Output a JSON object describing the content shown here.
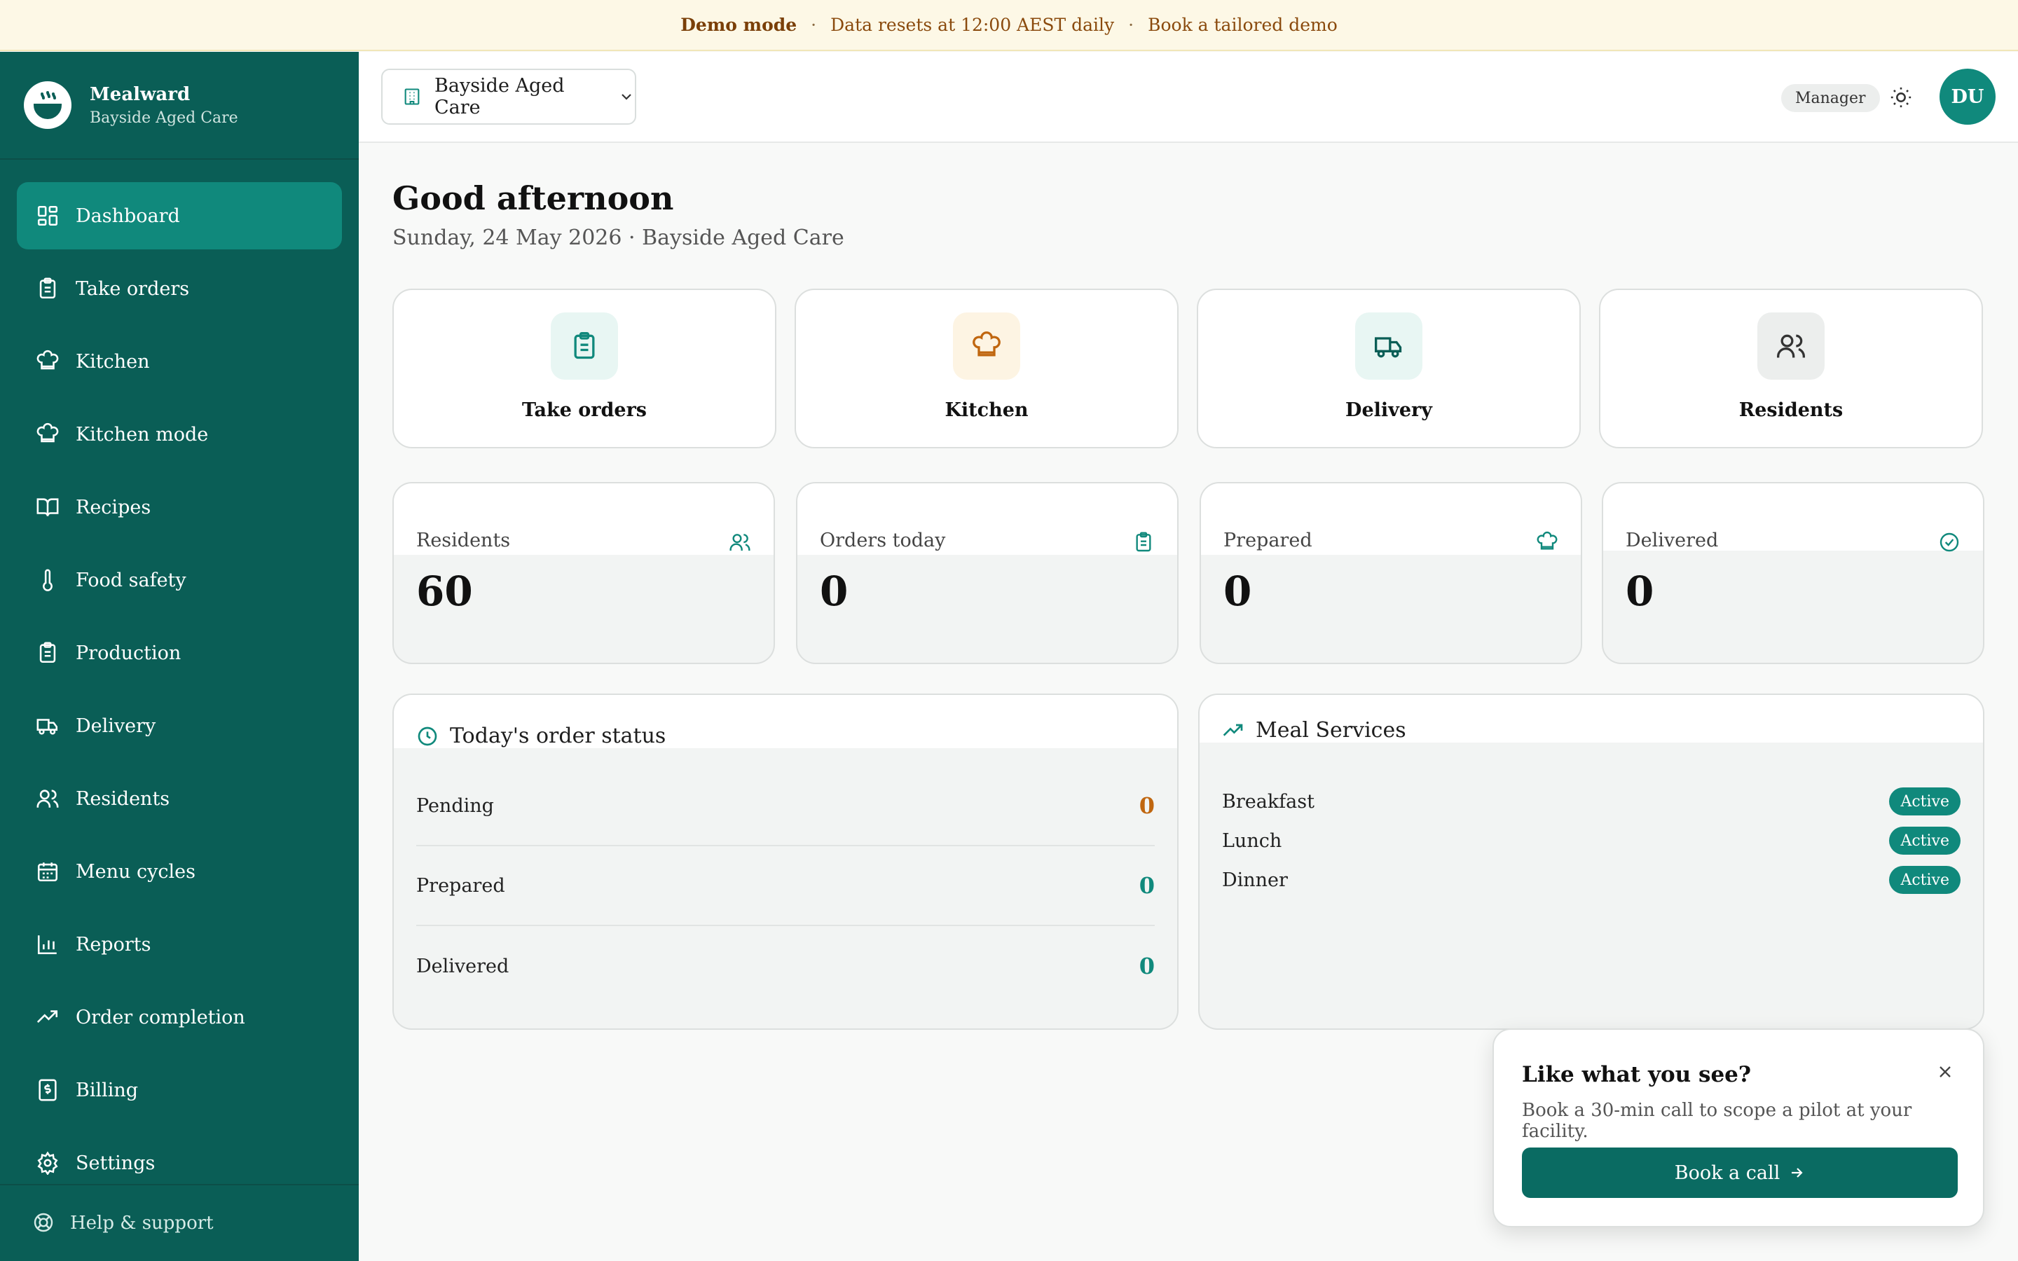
{
  "banner": {
    "mode": "Demo mode",
    "reset": "Data resets at 12:00 AEST daily",
    "demo_link": "Book a tailored demo",
    "separator": "·"
  },
  "brand": {
    "name": "Mealward",
    "facility": "Bayside Aged Care"
  },
  "sidebar": {
    "items": [
      {
        "label": "Dashboard",
        "icon": "dashboard-icon",
        "active": true
      },
      {
        "label": "Take orders",
        "icon": "clipboard-icon"
      },
      {
        "label": "Kitchen",
        "icon": "chef-hat-icon"
      },
      {
        "label": "Kitchen mode",
        "icon": "chef-hat-icon"
      },
      {
        "label": "Recipes",
        "icon": "book-open-icon"
      },
      {
        "label": "Food safety",
        "icon": "thermometer-icon"
      },
      {
        "label": "Production",
        "icon": "clipboard-list-icon"
      },
      {
        "label": "Delivery",
        "icon": "truck-icon"
      },
      {
        "label": "Residents",
        "icon": "users-icon"
      },
      {
        "label": "Menu cycles",
        "icon": "calendar-icon"
      },
      {
        "label": "Reports",
        "icon": "bar-chart-icon"
      },
      {
        "label": "Order completion",
        "icon": "trending-up-icon"
      },
      {
        "label": "Billing",
        "icon": "receipt-icon"
      },
      {
        "label": "Settings",
        "icon": "gear-icon"
      }
    ],
    "help": "Help & support"
  },
  "header": {
    "facility_select": "Bayside Aged Care",
    "role": "Manager",
    "avatar_initials": "DU"
  },
  "main": {
    "greeting": "Good afternoon",
    "date_line": "Sunday, 24 May 2026 · Bayside Aged Care",
    "quick_actions": [
      {
        "label": "Take orders",
        "icon": "clipboard-icon",
        "bg": "#e8f6f3",
        "fg": "#10897c"
      },
      {
        "label": "Kitchen",
        "icon": "chef-hat-icon",
        "bg": "#fdf4e3",
        "fg": "#c0660f"
      },
      {
        "label": "Delivery",
        "icon": "truck-icon",
        "bg": "#e8f6f3",
        "fg": "#0a5e56"
      },
      {
        "label": "Residents",
        "icon": "users-icon",
        "bg": "#eceeed",
        "fg": "#333333"
      }
    ],
    "stats": [
      {
        "label": "Residents",
        "value": "60",
        "icon": "users-icon"
      },
      {
        "label": "Orders today",
        "value": "0",
        "icon": "clipboard-icon"
      },
      {
        "label": "Prepared",
        "value": "0",
        "icon": "chef-hat-icon"
      },
      {
        "label": "Delivered",
        "value": "0",
        "icon": "check-circle-icon"
      }
    ],
    "order_status": {
      "title": "Today's order status",
      "rows": [
        {
          "label": "Pending",
          "value": "0",
          "color": "#c0660f"
        },
        {
          "label": "Prepared",
          "value": "0",
          "color": "#10897c"
        },
        {
          "label": "Delivered",
          "value": "0",
          "color": "#10897c"
        }
      ]
    },
    "meal_services": {
      "title": "Meal Services",
      "rows": [
        {
          "label": "Breakfast",
          "status": "Active"
        },
        {
          "label": "Lunch",
          "status": "Active"
        },
        {
          "label": "Dinner",
          "status": "Active"
        }
      ]
    }
  },
  "popup": {
    "title": "Like what you see?",
    "desc": "Book a 30-min call to scope a pilot at your facility.",
    "button": "Book a call"
  },
  "colors": {
    "sidebar": "#0a5e56",
    "accent": "#10897c",
    "warning": "#c0660f"
  }
}
